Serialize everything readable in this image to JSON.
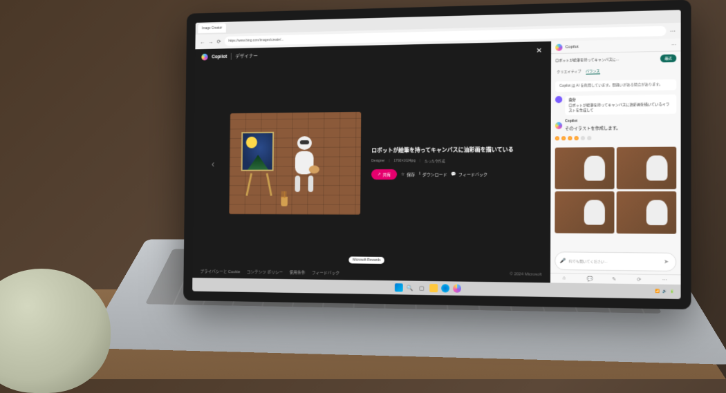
{
  "browser": {
    "tab_title": "Image Creator",
    "url": "https://www.bing.com/images/create/..."
  },
  "viewer": {
    "brand": "Copilot",
    "subtitle": "デザイナー",
    "prompt": "ロボットが絵筆を持ってキャンバスに油彩画を描いている",
    "meta_tool": "Designer",
    "meta_dims": "1792×1024jpg",
    "meta_time": "たった今作成",
    "share_label": "共有",
    "save_label": "保存",
    "download_label": "ダウンロード",
    "feedback_label": "フィードバック",
    "rewards_tooltip": "Microsoft Rewards",
    "footer_privacy": "プライバシーと Cookie",
    "footer_policy": "コンテンツ ポリシー",
    "footer_terms": "使用条件",
    "footer_feedback": "フィードバック",
    "footer_copyright": "© 2024 Microsoft"
  },
  "sidebar": {
    "title": "Copilot",
    "topic": "ロボットが絵筆を持ってキャンバスに...",
    "chat_btn": "最近",
    "style_creative": "クリエイティブ",
    "style_balanced": "バランス",
    "system_note": "Copilot は AI を利用しています。間違いがある場合があります。",
    "user_label": "自分",
    "user_prompt": "ロボットが絵筆を持ってキャンバスに油彩画を描いているイラストを生成して",
    "copilot_label": "Copilot",
    "copilot_reply": "そのイラストを作成します。",
    "input_placeholder": "何でも聞いてください..."
  },
  "taskbar": {
    "search_placeholder": "検索"
  }
}
